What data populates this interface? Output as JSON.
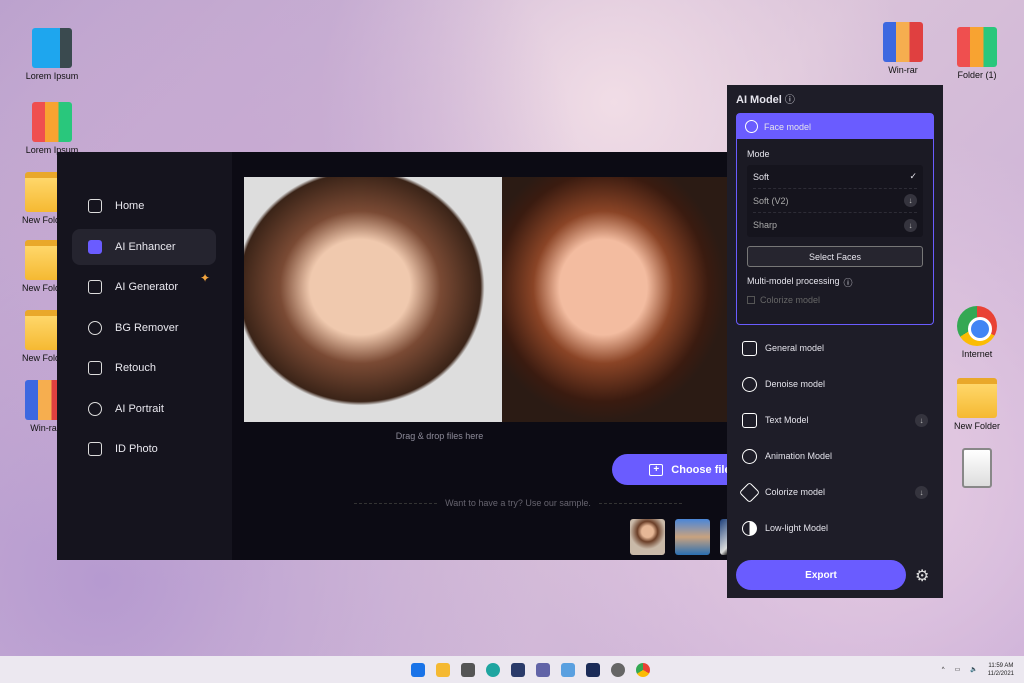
{
  "desktop": {
    "left_icons": [
      "Lorem Ipsum",
      "Lorem Ipsum",
      "New Folder",
      "New Folder",
      "New Folder",
      "Win-rar"
    ],
    "right_icons": [
      "Win-rar",
      "Folder (1)",
      "Internet",
      "New Folder"
    ]
  },
  "sidebar": {
    "items": [
      {
        "label": "Home"
      },
      {
        "label": "AI Enhancer"
      },
      {
        "label": "AI Generator"
      },
      {
        "label": "BG Remover"
      },
      {
        "label": "Retouch"
      },
      {
        "label": "AI Portrait"
      },
      {
        "label": "ID Photo"
      }
    ]
  },
  "main": {
    "drag_text": "Drag & drop files here",
    "choose_label": "Choose files",
    "try_text": "Want to have a try? Use our sample."
  },
  "panel": {
    "title": "AI Model",
    "face_model": "Face model",
    "mode_label": "Mode",
    "modes": [
      "Soft",
      "Soft (V2)",
      "Sharp"
    ],
    "select_faces": "Select Faces",
    "multi": "Multi-model processing",
    "colorize_check": "Colorize model",
    "models": [
      "General model",
      "Denoise model",
      "Text Model",
      "Animation Model",
      "Colorize model",
      "Low-light Model"
    ],
    "export": "Export"
  },
  "taskbar": {
    "time": "11:59 AM",
    "date": "11/2/2021"
  },
  "colors": {
    "accent": "#6a5cff"
  }
}
